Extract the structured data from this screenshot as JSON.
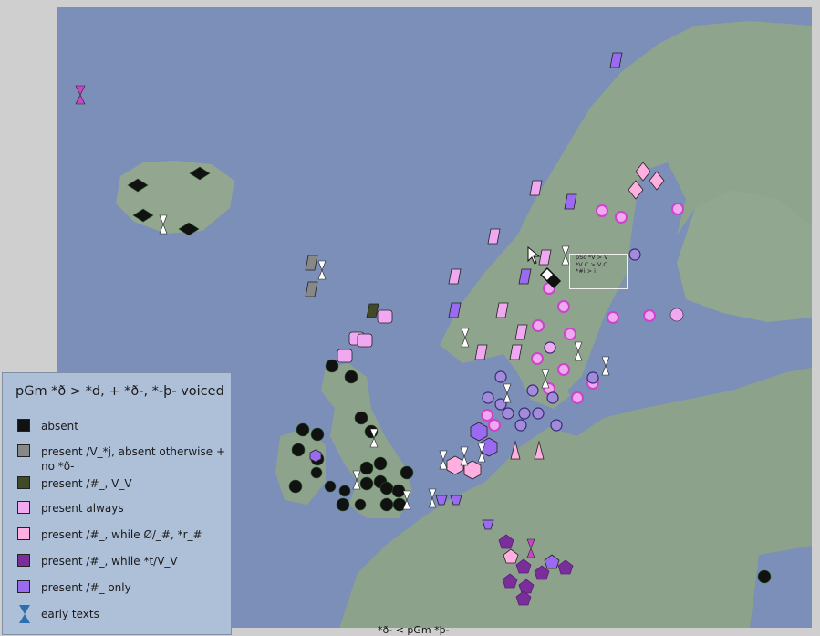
{
  "legend": {
    "title": "pGm *ð > *d, + *ð-, *-þ- voiced",
    "items": [
      {
        "id": "absent",
        "label": "absent",
        "color": "#111111",
        "shape": "square"
      },
      {
        "id": "present-vj",
        "label": "present /V_*j, absent otherwise + no *ð-",
        "color": "#888888",
        "shape": "square"
      },
      {
        "id": "present-hash-vv",
        "label": "present /#_, V_V",
        "color": "#404a28",
        "shape": "square"
      },
      {
        "id": "present-always",
        "label": "present always",
        "color": "#f0a8f0",
        "shape": "square"
      },
      {
        "id": "present-hash-r",
        "label": "present /#_, while Ø/_#, *r_#",
        "color": "#ffb0e0",
        "shape": "square"
      },
      {
        "id": "present-hash-t",
        "label": "present /#_, while *t/V_V",
        "color": "#7a2e9a",
        "shape": "square"
      },
      {
        "id": "present-hash-only",
        "label": "present /#_ only",
        "color": "#9a6af0",
        "shape": "square"
      },
      {
        "id": "early-texts",
        "label": "early texts",
        "color": "#2a6fb0",
        "shape": "hourglass"
      }
    ]
  },
  "popup": {
    "lines": [
      "pSc *V > V",
      "*V C > V,C",
      "*#i > i"
    ]
  },
  "footer": "*ð- < pGm *þ-",
  "colors": {
    "sea": "#7b8fb8",
    "land": "#8fa58e",
    "accent": "#cc44cc"
  }
}
